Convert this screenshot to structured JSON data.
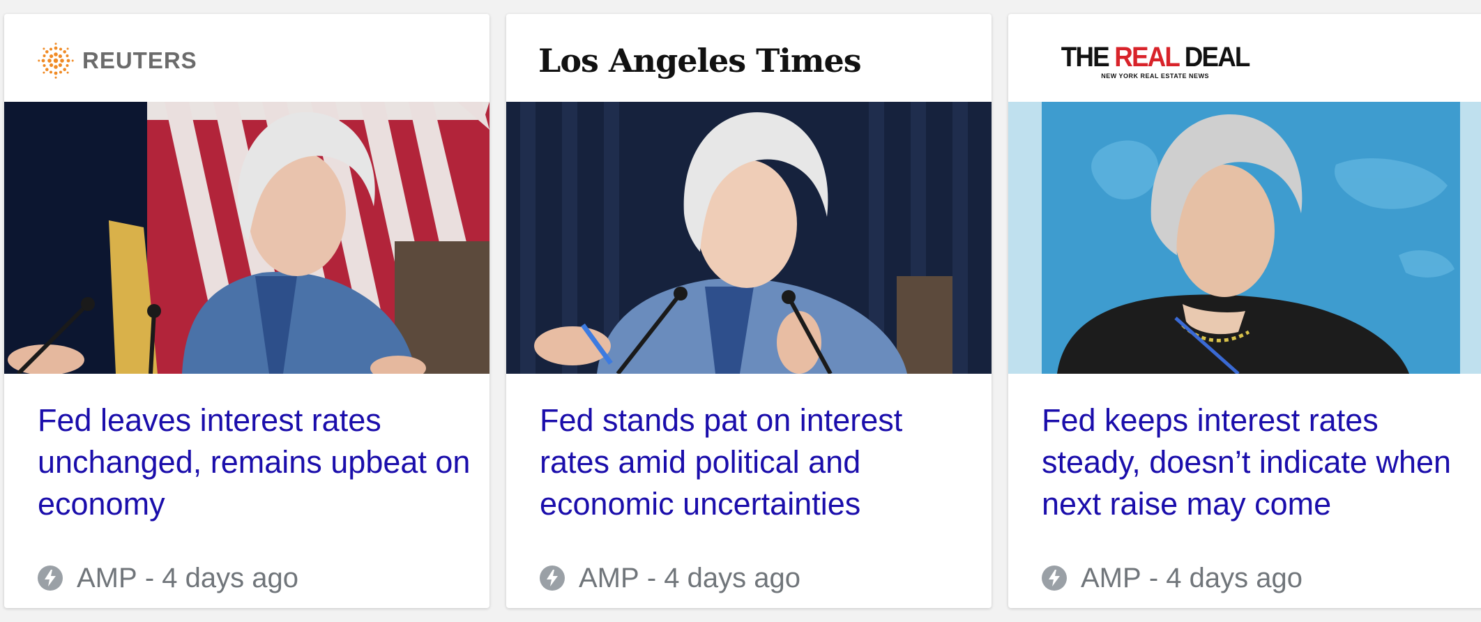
{
  "cards": [
    {
      "source": "REUTERS",
      "headline": "Fed leaves interest rates unchanged, remains upbeat on economy",
      "amp_label": "AMP",
      "separator": "-",
      "time": "4 days ago"
    },
    {
      "source": "Los Angeles Times",
      "headline": "Fed stands pat on interest rates amid political and economic uncertainties",
      "amp_label": "AMP",
      "separator": "-",
      "time": "4 days ago"
    },
    {
      "source_part1": "THE ",
      "source_part2": "REAL",
      "source_part3": " DEAL",
      "source_tagline": "NEW YORK REAL ESTATE NEWS",
      "headline": "Fed keeps interest rates steady, doesn’t indicate when next raise may come",
      "amp_label": "AMP",
      "separator": "-",
      "time": "4 days ago"
    }
  ],
  "colors": {
    "headline": "#1a0dab",
    "meta": "#70757a",
    "reuters_orange": "#f08a24",
    "trd_red": "#d8232a"
  },
  "icons": {
    "amp": "lightning-bolt-icon",
    "reuters": "reuters-dots-icon"
  }
}
